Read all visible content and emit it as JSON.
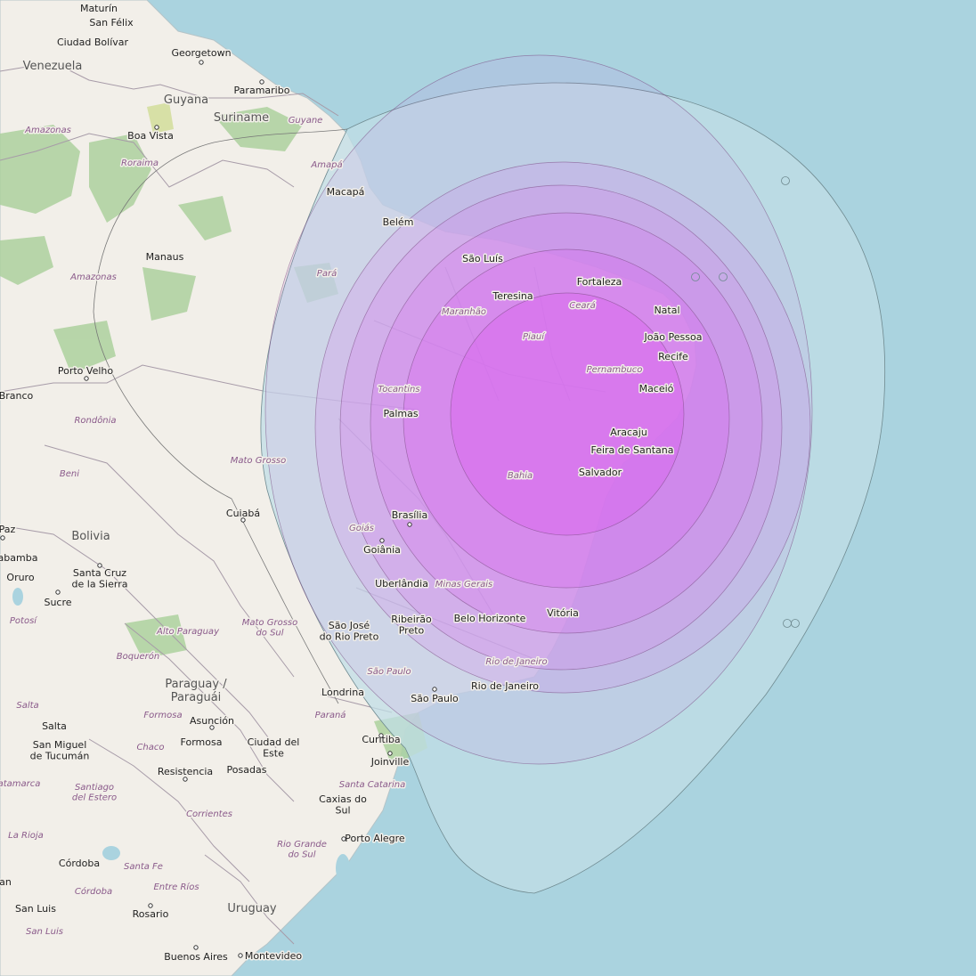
{
  "colors": {
    "ocean": "#aad3df",
    "land": "#f2efe9",
    "forest": "#add19e",
    "park": "#c8dbb0",
    "border": "#9e9ba3",
    "beam_outer": "#c0dee6",
    "beam": "#dc5ff0"
  },
  "countries": [
    {
      "name": "Venezuela"
    },
    {
      "name": "Guyana"
    },
    {
      "name": "Suriname"
    },
    {
      "name": "Bolivia"
    },
    {
      "name": "Paraguay / Paraguái"
    },
    {
      "name": "Uruguay"
    }
  ],
  "regions": [
    {
      "name": "Guyane"
    },
    {
      "name": "Amapá"
    },
    {
      "name": "Amazonas"
    },
    {
      "name": "Roraima"
    },
    {
      "name": "Amazonas"
    },
    {
      "name": "Pará"
    },
    {
      "name": "Maranhão"
    },
    {
      "name": "Ceará"
    },
    {
      "name": "Piauí"
    },
    {
      "name": "Pernambuco"
    },
    {
      "name": "Tocantins"
    },
    {
      "name": "Rondônia"
    },
    {
      "name": "Mato Grosso"
    },
    {
      "name": "Beni"
    },
    {
      "name": "Bahia"
    },
    {
      "name": "Goiás"
    },
    {
      "name": "Minas Gerais"
    },
    {
      "name": "Mato Grosso do Sul"
    },
    {
      "name": "Alto Paraguay"
    },
    {
      "name": "Boquerón"
    },
    {
      "name": "São Paulo"
    },
    {
      "name": "Rio de Janeiro"
    },
    {
      "name": "Paraná"
    },
    {
      "name": "Santa Catarina"
    },
    {
      "name": "Rio Grande do Sul"
    },
    {
      "name": "Formosa"
    },
    {
      "name": "Chaco"
    },
    {
      "name": "Santiago del Estero"
    },
    {
      "name": "Corrientes"
    },
    {
      "name": "Catamarca"
    },
    {
      "name": "La Rioja"
    },
    {
      "name": "Santa Fe"
    },
    {
      "name": "Entre Ríos"
    },
    {
      "name": "Córdoba"
    },
    {
      "name": "San Luis"
    },
    {
      "name": "Potosí"
    },
    {
      "name": "Salta"
    }
  ],
  "cities": [
    {
      "name": "Maturín"
    },
    {
      "name": "San Félix"
    },
    {
      "name": "Ciudad Bolívar"
    },
    {
      "name": "Georgetown"
    },
    {
      "name": "Paramaribo"
    },
    {
      "name": "Boa Vista"
    },
    {
      "name": "Macapá"
    },
    {
      "name": "Belém"
    },
    {
      "name": "Manaus"
    },
    {
      "name": "São Luís"
    },
    {
      "name": "Fortaleza"
    },
    {
      "name": "Teresina"
    },
    {
      "name": "Natal"
    },
    {
      "name": "João Pessoa"
    },
    {
      "name": "Recife"
    },
    {
      "name": "Maceió"
    },
    {
      "name": "Porto Velho"
    },
    {
      "name": "Branco"
    },
    {
      "name": "Palmas"
    },
    {
      "name": "Aracaju"
    },
    {
      "name": "Feira de Santana"
    },
    {
      "name": "Salvador"
    },
    {
      "name": "Cuiabá"
    },
    {
      "name": "Paz"
    },
    {
      "name": "Brasília"
    },
    {
      "name": "Goiânia"
    },
    {
      "name": "abamba"
    },
    {
      "name": "Santa Cruz de la Sierra"
    },
    {
      "name": "Oruro"
    },
    {
      "name": "Sucre"
    },
    {
      "name": "Uberlândia"
    },
    {
      "name": "Belo Horizonte"
    },
    {
      "name": "Vitória"
    },
    {
      "name": "São José do Rio Preto"
    },
    {
      "name": "Ribeirão Preto"
    },
    {
      "name": "Rio de Janeiro"
    },
    {
      "name": "Londrina"
    },
    {
      "name": "São Paulo"
    },
    {
      "name": "Asunción"
    },
    {
      "name": "Salta"
    },
    {
      "name": "San Miguel de Tucumán"
    },
    {
      "name": "Formosa"
    },
    {
      "name": "Ciudad del Este"
    },
    {
      "name": "Curitiba"
    },
    {
      "name": "Joinville"
    },
    {
      "name": "Resistencia"
    },
    {
      "name": "Posadas"
    },
    {
      "name": "Caxias do Sul"
    },
    {
      "name": "Porto Alegre"
    },
    {
      "name": "Córdoba"
    },
    {
      "name": "San Luis"
    },
    {
      "name": "Rosario"
    },
    {
      "name": "Buenos Aires"
    },
    {
      "name": "Montevideo"
    },
    {
      "name": "an"
    }
  ],
  "coverage_contours": [
    {
      "level": 1
    },
    {
      "level": 2
    },
    {
      "level": 3
    },
    {
      "level": 4
    },
    {
      "level": 5
    },
    {
      "level": 6
    },
    {
      "level": 7
    }
  ]
}
